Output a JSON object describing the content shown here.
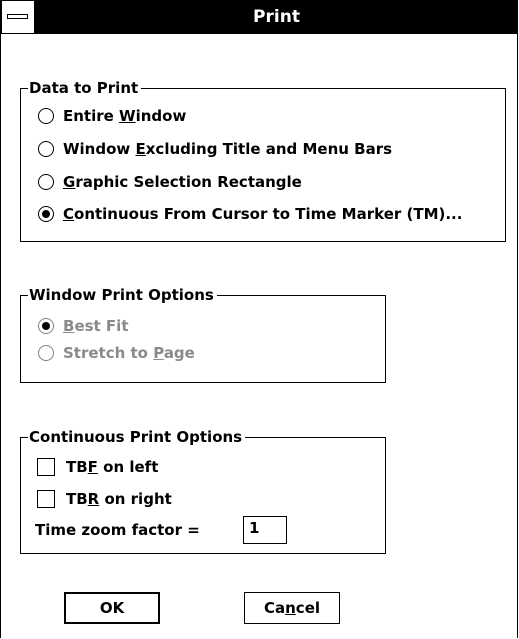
{
  "window": {
    "title": "Print"
  },
  "data_to_print": {
    "label": "Data to Print",
    "options": [
      {
        "pre": "Entire ",
        "mn": "W",
        "post": "indow",
        "checked": false
      },
      {
        "pre": "Window ",
        "mn": "E",
        "post": "xcluding Title and Menu Bars",
        "checked": false
      },
      {
        "pre": "",
        "mn": "G",
        "post": "raphic Selection Rectangle",
        "checked": false
      },
      {
        "pre": "",
        "mn": "C",
        "post": "ontinuous From Cursor to Time Marker (TM)...",
        "checked": true
      }
    ]
  },
  "window_print_options": {
    "label": "Window Print Options",
    "enabled": false,
    "options": [
      {
        "pre": "",
        "mn": "B",
        "post": "est Fit",
        "checked": true
      },
      {
        "pre": "Stretch to ",
        "mn": "P",
        "post": "age",
        "checked": false
      }
    ]
  },
  "continuous_print_options": {
    "label": "Continuous Print Options",
    "tbf": {
      "pre": "TB",
      "mn": "F",
      "post": " on left",
      "checked": false
    },
    "tbr": {
      "pre": "TB",
      "mn": "R",
      "post": " on right",
      "checked": false
    },
    "zoom_label": "Time zoom factor =",
    "zoom_value": "1"
  },
  "buttons": {
    "ok_label": "OK",
    "cancel_pre": "Ca",
    "cancel_mn": "n",
    "cancel_post": "cel"
  }
}
